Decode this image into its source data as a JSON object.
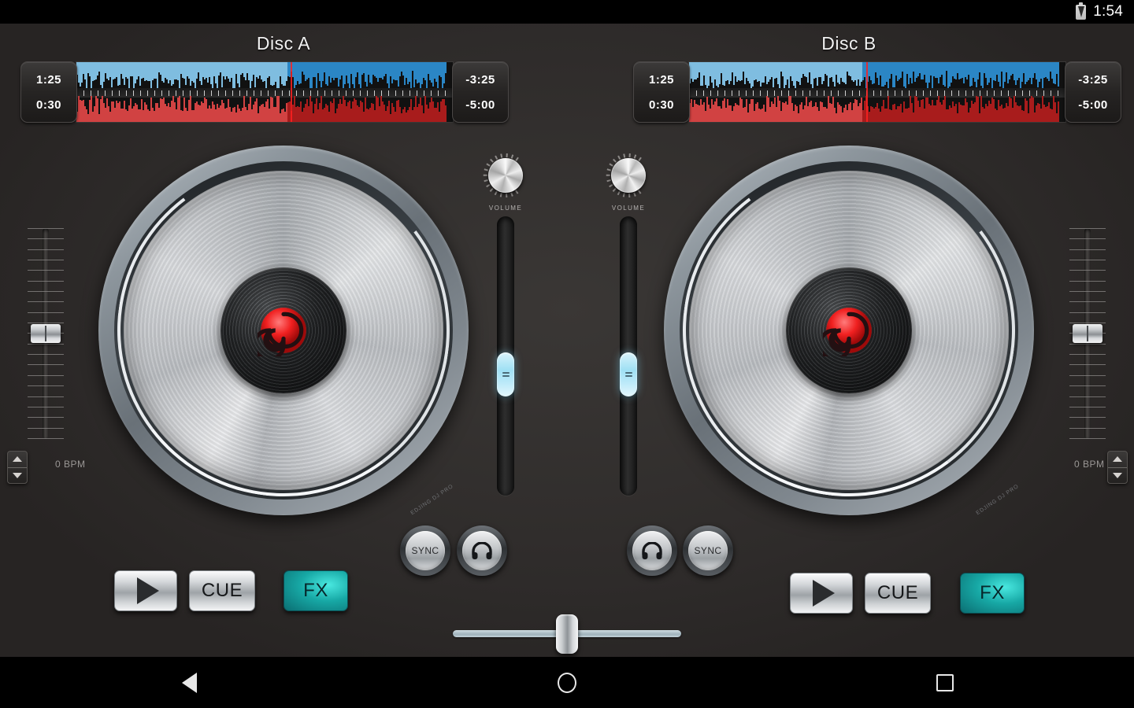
{
  "status_bar": {
    "time": "1:54",
    "battery_icon": "battery-charging-icon"
  },
  "decks": [
    {
      "id": "a",
      "title": "Disc A",
      "waveform": {
        "elapsed": "1:25",
        "cue_time": "0:30",
        "remaining": "-3:25",
        "total_remaining": "-5:00",
        "top_color": "#2b86c5",
        "top_played_color": "#7fbde0",
        "bottom_color": "#a81c1c",
        "bottom_played_color": "#d14242",
        "playhead_percent": 57
      },
      "volume_knob_label": "VOLUME",
      "volume_slider_percent": 42,
      "pitch_bpm": "0 BPM",
      "pitch_percent": 50,
      "sync_label": "SYNC",
      "cue_headphone_icon": "headphone-icon",
      "play_icon": "play-icon",
      "cue_label": "CUE",
      "fx_label": "FX"
    },
    {
      "id": "b",
      "title": "Disc B",
      "waveform": {
        "elapsed": "1:25",
        "cue_time": "0:30",
        "remaining": "-3:25",
        "total_remaining": "-5:00",
        "top_color": "#2b86c5",
        "top_played_color": "#7fbde0",
        "bottom_color": "#a81c1c",
        "bottom_played_color": "#d14242",
        "playhead_percent": 47
      },
      "volume_knob_label": "VOLUME",
      "volume_slider_percent": 42,
      "pitch_bpm": "0 BPM",
      "pitch_percent": 50,
      "sync_label": "SYNC",
      "cue_headphone_icon": "headphone-icon",
      "play_icon": "play-icon",
      "cue_label": "CUE",
      "fx_label": "FX"
    }
  ],
  "crossfader": {
    "position_percent": 50
  },
  "nav_bar": {
    "back": "back-icon",
    "home": "home-icon",
    "recents": "recents-icon"
  },
  "colors": {
    "background": "#2f2c2b",
    "accent_teal": "#17a8a5",
    "accent_cyan": "#9fe0f4",
    "waveform_blue": "#2b86c5",
    "waveform_red": "#a81c1c",
    "playhead_red": "#ff2020"
  }
}
